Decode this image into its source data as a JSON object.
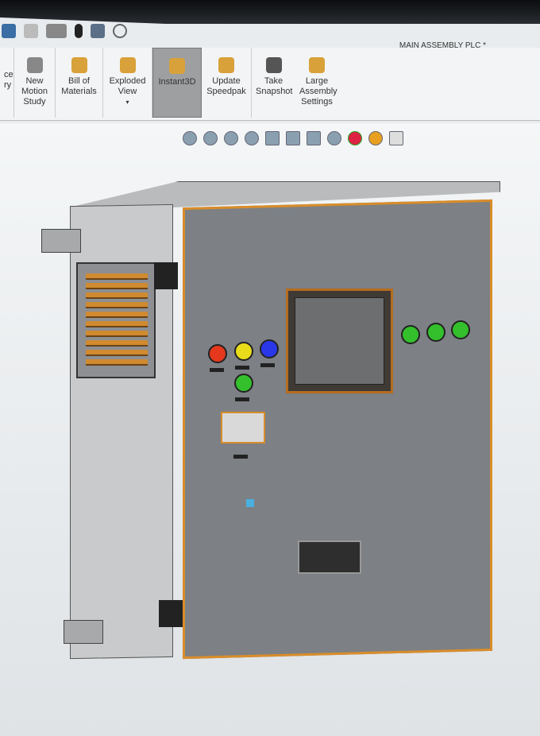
{
  "window": {
    "title": "MAIN ASSEMBLY PLC *"
  },
  "quick_access": {
    "icons": [
      "print-icon",
      "undo-icon",
      "select-icon",
      "rebuild-icon",
      "file-properties-icon",
      "options-icon"
    ]
  },
  "ribbon": {
    "items": [
      {
        "label": "ce\nry"
      },
      {
        "label": "New Motion Study",
        "icon": "motion-study-icon"
      },
      {
        "label": "Bill of Materials",
        "icon": "bom-icon"
      },
      {
        "label": "Exploded View",
        "icon": "exploded-view-icon"
      },
      {
        "label": "Instant3D",
        "icon": "instant3d-icon",
        "active": true
      },
      {
        "label": "Update Speedpak",
        "icon": "speedpak-icon"
      },
      {
        "label": "Take Snapshot",
        "icon": "camera-icon"
      },
      {
        "label": "Large Assembly Settings",
        "icon": "large-assembly-icon"
      }
    ]
  },
  "view_toolbar": {
    "icons": [
      "zoom-to-fit-icon",
      "zoom-area-icon",
      "previous-view-icon",
      "section-view-icon",
      "dynamic-annotation-icon",
      "view-orientation-icon",
      "display-style-icon",
      "hide-show-icon",
      "appearance-icon",
      "scene-icon",
      "view-settings-icon"
    ]
  },
  "colors": {
    "door_edge": "#d98d2a",
    "red": "#e5381c",
    "yellow": "#e9dc1a",
    "blue": "#2a37e8",
    "green": "#33c02c"
  }
}
